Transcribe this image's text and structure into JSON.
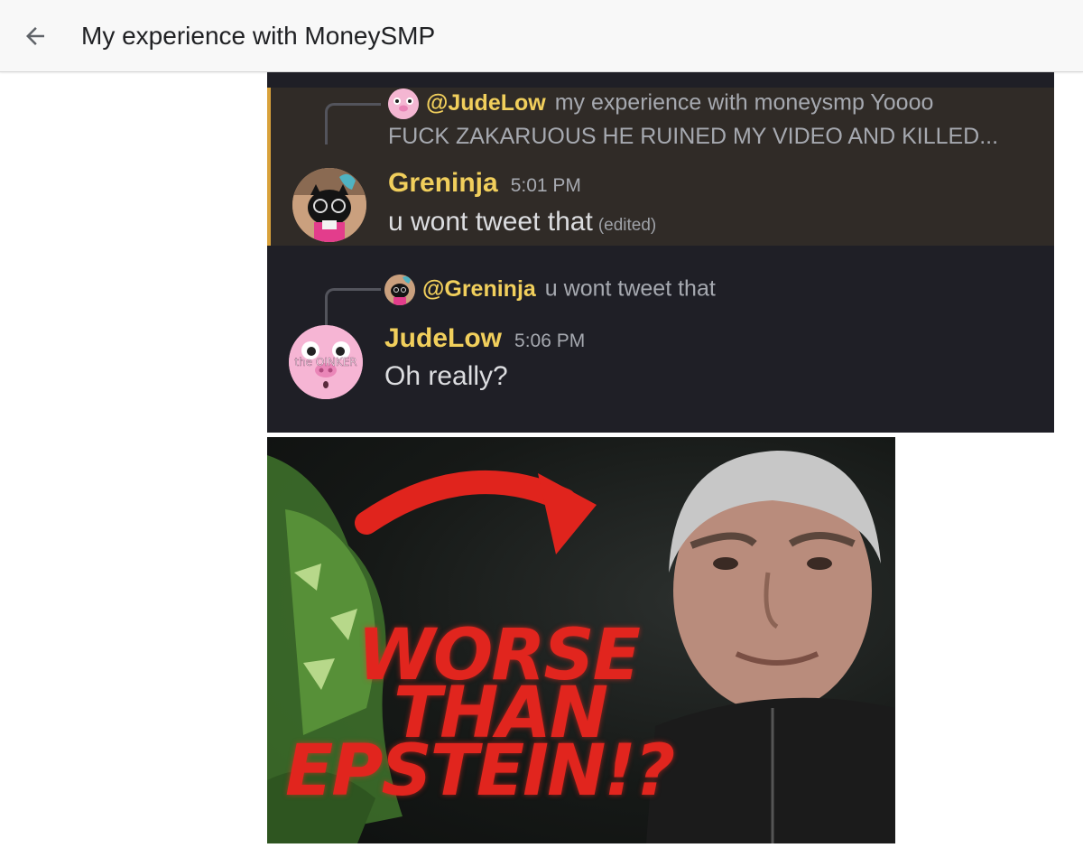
{
  "header": {
    "back_icon": "arrow-left-icon",
    "title": "My experience with MoneySMP"
  },
  "discord": {
    "messages": [
      {
        "reply_to_user": "@JudeLow",
        "reply_preview_line1": "my experience with moneysmp  Yoooo",
        "reply_preview_line2": "FUCK ZAKARUOUS HE RUINED MY VIDEO AND KILLED...",
        "username": "Greninja",
        "timestamp": "5:01 PM",
        "text": "u wont tweet that",
        "edited_label": "(edited)",
        "highlighted": true
      },
      {
        "reply_to_user": "@Greninja",
        "reply_preview_line1": "u wont tweet that",
        "username": "JudeLow",
        "timestamp": "5:06 PM",
        "text": "Oh really?",
        "avatar_text": "the OINKER"
      }
    ],
    "colors": {
      "name": "#f1cf5c",
      "highlight_bar": "#d9a23b",
      "background": "#1f1f26"
    }
  },
  "meme": {
    "line1": "WORSE",
    "line2": "THAN",
    "line3": "EPSTEIN!?"
  }
}
